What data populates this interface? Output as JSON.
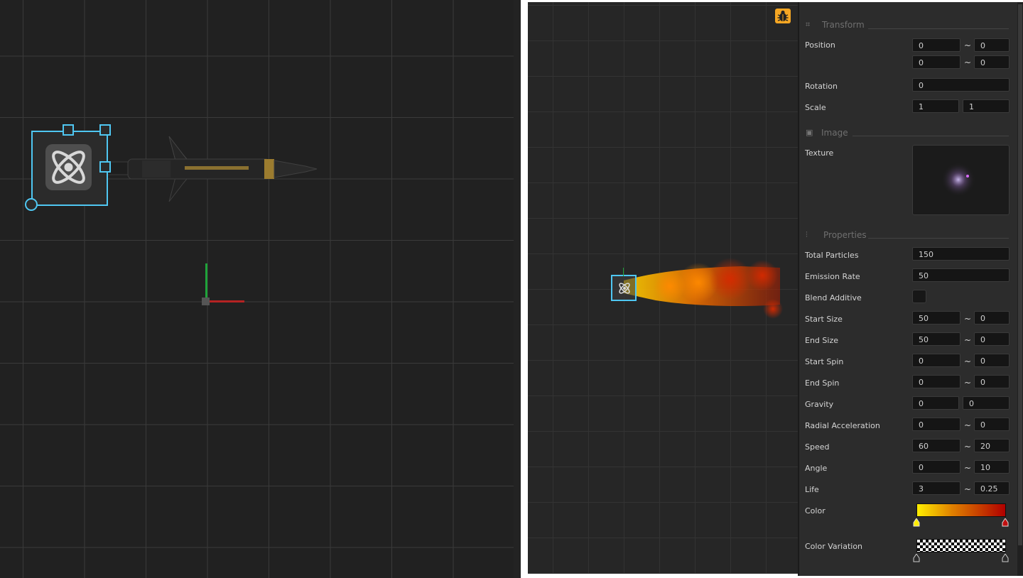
{
  "colors": {
    "accent": "#4fc7f2",
    "debug_button": "#f5a623",
    "axis_x": "#c0392b",
    "axis_y": "#27ae60"
  },
  "icons": {
    "emitter": "atom-icon",
    "debug": "bug-icon",
    "transform": "transform-icon",
    "image": "image-icon",
    "properties": "sliders-icon"
  },
  "inspector": {
    "transform": {
      "title": "Transform",
      "position_label": "Position",
      "position": {
        "x_min": "0",
        "x_max": "0",
        "y_min": "0",
        "y_max": "0"
      },
      "rotation_label": "Rotation",
      "rotation": "0",
      "scale_label": "Scale",
      "scale": {
        "x": "1",
        "y": "1"
      }
    },
    "image": {
      "title": "Image",
      "texture_label": "Texture"
    },
    "properties": {
      "title": "Properties",
      "total_particles": {
        "label": "Total Particles",
        "value": "150"
      },
      "emission_rate": {
        "label": "Emission Rate",
        "value": "50"
      },
      "blend_additive": {
        "label": "Blend Additive",
        "checked": false
      },
      "start_size": {
        "label": "Start Size",
        "min": "50",
        "max": "0"
      },
      "end_size": {
        "label": "End Size",
        "min": "50",
        "max": "0"
      },
      "start_spin": {
        "label": "Start Spin",
        "min": "0",
        "max": "0"
      },
      "end_spin": {
        "label": "End Spin",
        "min": "0",
        "max": "0"
      },
      "gravity": {
        "label": "Gravity",
        "x": "0",
        "y": "0"
      },
      "radial_acceleration": {
        "label": "Radial Acceleration",
        "min": "0",
        "max": "0"
      },
      "speed": {
        "label": "Speed",
        "min": "60",
        "max": "20"
      },
      "angle": {
        "label": "Angle",
        "min": "0",
        "max": "10"
      },
      "life": {
        "label": "Life",
        "min": "3",
        "max": "0.25"
      },
      "color": {
        "label": "Color",
        "start": "#ffee00",
        "end": "#b00000"
      },
      "color_variation": {
        "label": "Color Variation"
      }
    },
    "tilde": "~"
  }
}
